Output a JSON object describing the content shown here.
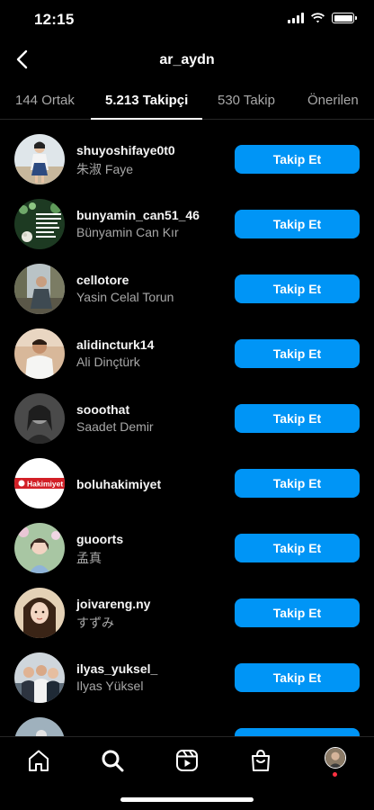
{
  "status_bar": {
    "time": "12:15"
  },
  "header": {
    "title": "ar_aydn"
  },
  "tabs": [
    {
      "label": "144 Ortak"
    },
    {
      "label": "5.213 Takipçi"
    },
    {
      "label": "530 Takip"
    },
    {
      "label": "Önerilen"
    }
  ],
  "follow_label": "Takip Et",
  "users": [
    {
      "username": "shuyoshifaye0t0",
      "name": "朱淑 Faye"
    },
    {
      "username": "bunyamin_can51_46",
      "name": "Bünyamin Can Kır"
    },
    {
      "username": "cellotore",
      "name": "Yasin Celal Torun"
    },
    {
      "username": "alidincturk14",
      "name": "Ali Dinçtürk"
    },
    {
      "username": "sooothat",
      "name": "Saadet Demir"
    },
    {
      "username": "boluhakimiyet",
      "name": ""
    },
    {
      "username": "guoorts",
      "name": "孟真"
    },
    {
      "username": "joivareng.ny",
      "name": "すずみ"
    },
    {
      "username": "ilyas_yuksel_",
      "name": "Ilyas Yüksel"
    }
  ],
  "avatar_logo_text": "Hakimiyet",
  "colors": {
    "accent": "#0095f6",
    "background": "#000000",
    "secondary_text": "#a8a8a8"
  }
}
